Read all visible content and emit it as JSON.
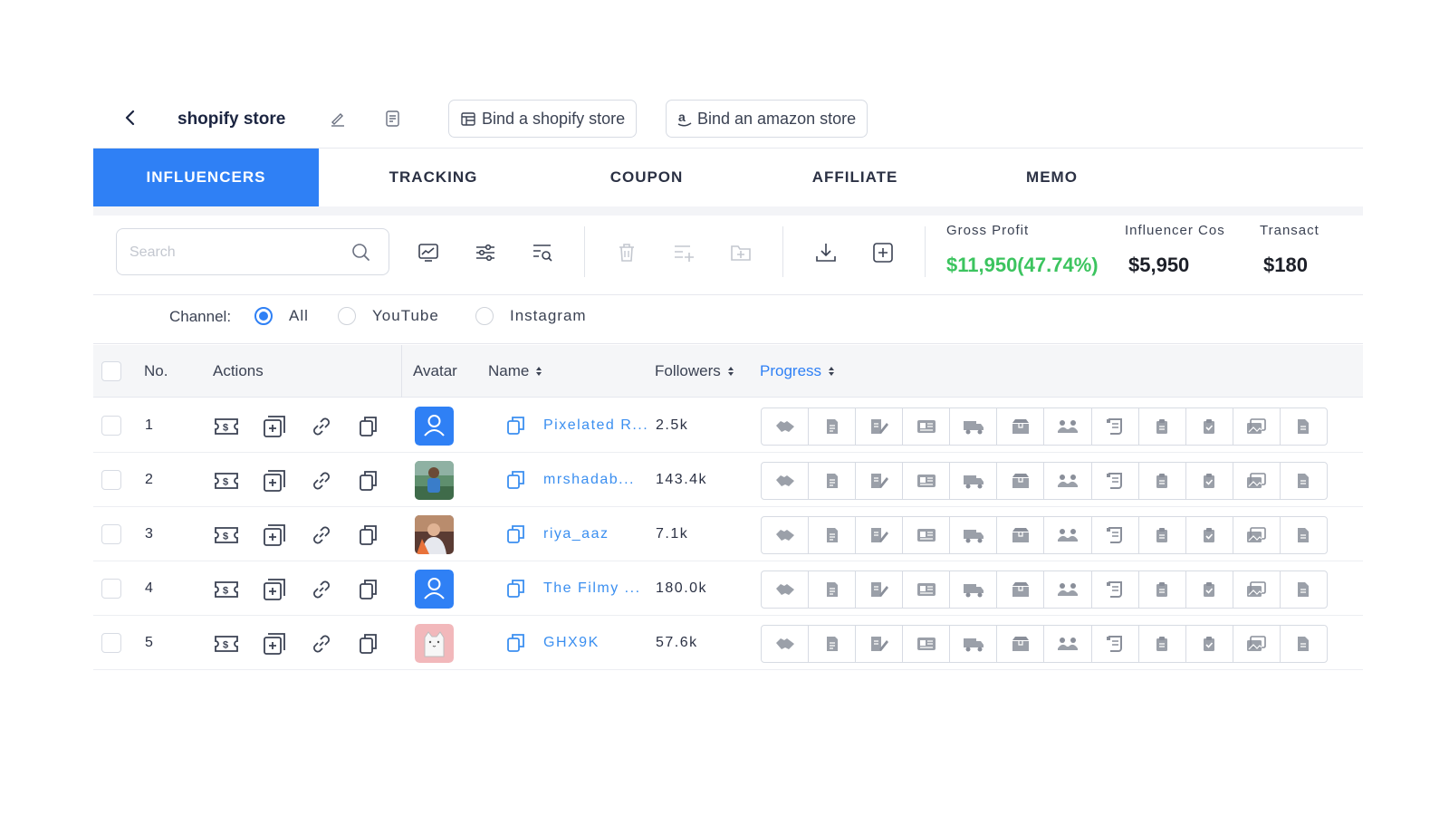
{
  "header": {
    "title": "shopify store",
    "bind_shopify_label": "Bind a shopify store",
    "bind_amazon_label": "Bind an amazon store"
  },
  "tabs": [
    {
      "label": "INFLUENCERS",
      "active": true
    },
    {
      "label": "TRACKING",
      "active": false
    },
    {
      "label": "COUPON",
      "active": false
    },
    {
      "label": "AFFILIATE",
      "active": false
    },
    {
      "label": "MEMO",
      "active": false
    }
  ],
  "search": {
    "placeholder": "Search",
    "value": ""
  },
  "stats": {
    "gross_profit_label": "Gross Profit",
    "gross_profit_value": "$11,950(47.74%)",
    "influencer_cost_label": "Influencer Cos",
    "influencer_cost_value": "$5,950",
    "transaction_label": "Transact",
    "transaction_value": "$180"
  },
  "channel": {
    "label": "Channel:",
    "options": [
      "All",
      "YouTube",
      "Instagram"
    ],
    "selected": "All"
  },
  "table": {
    "columns": {
      "no": "No.",
      "actions": "Actions",
      "avatar": "Avatar",
      "name": "Name",
      "followers": "Followers",
      "progress": "Progress"
    },
    "rows": [
      {
        "no": "1",
        "name": "Pixelated R...",
        "followers": "2.5k",
        "avatar": "default"
      },
      {
        "no": "2",
        "name": "mrshadab...",
        "followers": "143.4k",
        "avatar": "photo-green"
      },
      {
        "no": "3",
        "name": "riya_aaz",
        "followers": "7.1k",
        "avatar": "photo-orange"
      },
      {
        "no": "4",
        "name": "The Filmy ...",
        "followers": "180.0k",
        "avatar": "default"
      },
      {
        "no": "5",
        "name": "GHX9K",
        "followers": "57.6k",
        "avatar": "cat-pink"
      }
    ]
  },
  "colors": {
    "accent": "#2f80f5",
    "profit": "#3cc45f",
    "link": "#3b8ff0"
  },
  "icons": {
    "row_actions": [
      "coupon-icon",
      "add-box-icon",
      "link-icon",
      "copy-icon"
    ],
    "progress_steps": [
      "handshake-icon",
      "document-icon",
      "contract-edit-icon",
      "id-card-icon",
      "truck-icon",
      "package-icon",
      "cooperate-icon",
      "scroll-icon",
      "clipboard-icon",
      "clipboard-check-icon",
      "gallery-icon",
      "file-icon"
    ]
  }
}
